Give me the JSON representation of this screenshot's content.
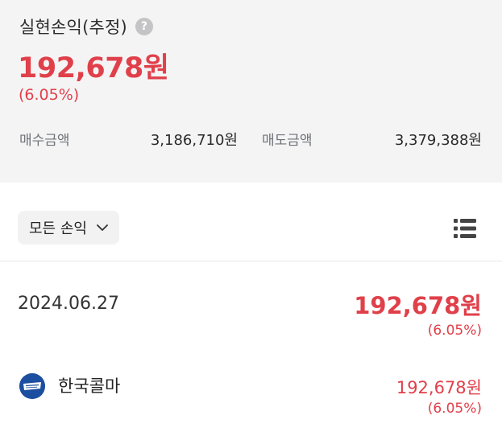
{
  "summary": {
    "title": "실현손익(추정)",
    "help_icon_glyph": "?",
    "amount": "192,678원",
    "rate": "(6.05%)",
    "buy_label": "매수금액",
    "buy_value": "3,186,710원",
    "sell_label": "매도금액",
    "sell_value": "3,379,388원"
  },
  "filter": {
    "label": "모든 손익",
    "icon": "chevron-down-icon",
    "view_icon": "list-icon"
  },
  "date_group": {
    "date": "2024.06.27",
    "amount": "192,678원",
    "rate": "(6.05%)"
  },
  "stocks": [
    {
      "name": "한국콜마",
      "logo_icon": "kolmar-logo-icon",
      "amount": "192,678원",
      "rate": "(6.05%)"
    }
  ],
  "colors": {
    "profit": "#e0404a",
    "summary_bg": "#f4f4f5",
    "logo_bg": "#1d4fa0"
  }
}
